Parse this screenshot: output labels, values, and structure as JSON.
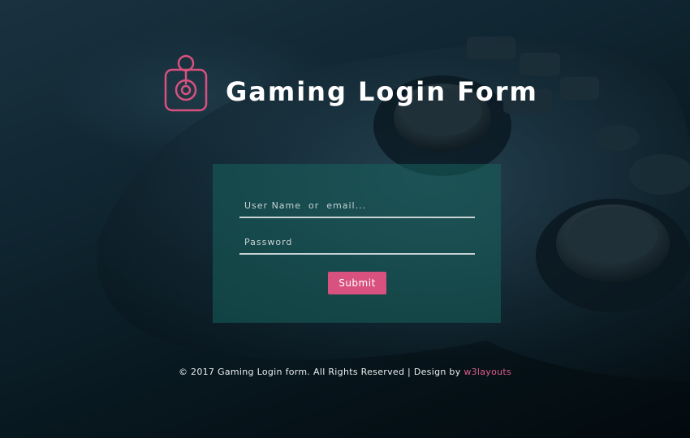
{
  "header": {
    "title": "Gaming Login Form",
    "logo_icon": "joystick-icon"
  },
  "form": {
    "username_placeholder": "User Name  or  email...",
    "password_placeholder": "Password",
    "submit_label": "Submit"
  },
  "footer": {
    "copyright_text": "© 2017 Gaming Login form. All Rights Reserved | Design by ",
    "designer_link": "w3layouts"
  },
  "colors": {
    "accent": "#d9517f",
    "panel": "#17625c",
    "link": "#e05c8f"
  }
}
